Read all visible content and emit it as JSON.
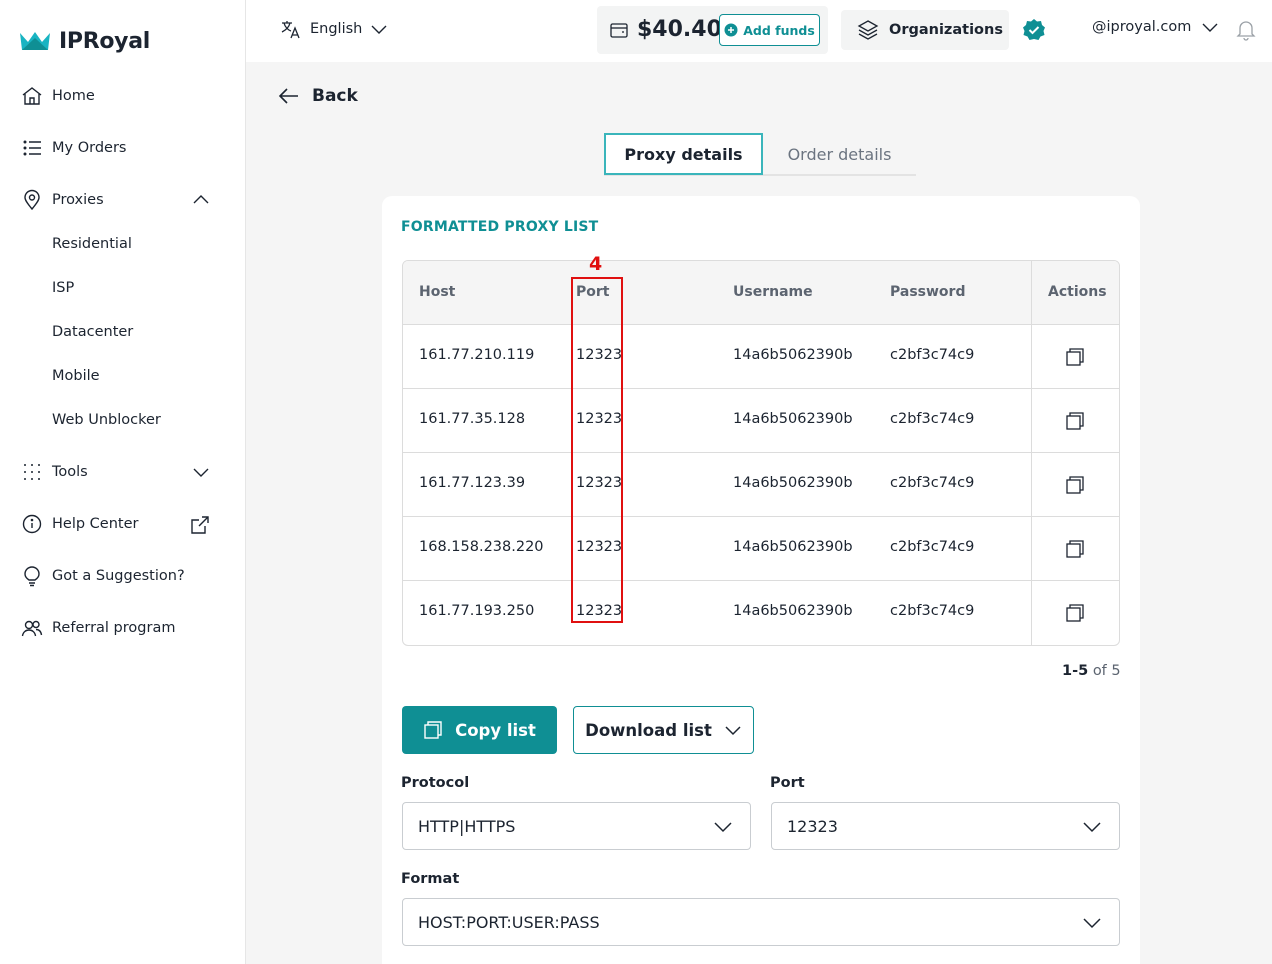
{
  "brand": {
    "name": "IPRoyal",
    "accent": "#0f8f94"
  },
  "sidebar": {
    "items": [
      {
        "label": "Home",
        "icon": "home-icon"
      },
      {
        "label": "My Orders",
        "icon": "list-icon"
      },
      {
        "label": "Proxies",
        "icon": "location-pin-icon"
      },
      {
        "label": "Tools",
        "icon": "dots-grid-icon"
      },
      {
        "label": "Help Center",
        "icon": "info-icon"
      },
      {
        "label": "Got a Suggestion?",
        "icon": "lightbulb-icon"
      },
      {
        "label": "Referral program",
        "icon": "users-icon"
      }
    ],
    "proxy_sub": [
      "Residential",
      "ISP",
      "Datacenter",
      "Mobile",
      "Web Unblocker"
    ]
  },
  "topbar": {
    "language": "English",
    "balance": "$40.40",
    "add_funds": "Add funds",
    "organizations": "Organizations",
    "user": "@iproyal.com"
  },
  "main": {
    "back": "Back",
    "tabs": [
      "Proxy details",
      "Order details"
    ],
    "section_title": "FORMATTED PROXY LIST",
    "columns": [
      "Host",
      "Port",
      "Username",
      "Password",
      "Actions"
    ],
    "rows": [
      {
        "host": "161.77.210.119",
        "port": "12323",
        "username": "14a6b5062390b",
        "password": "c2bf3c74c9"
      },
      {
        "host": "161.77.35.128",
        "port": "12323",
        "username": "14a6b5062390b",
        "password": "c2bf3c74c9"
      },
      {
        "host": "161.77.123.39",
        "port": "12323",
        "username": "14a6b5062390b",
        "password": "c2bf3c74c9"
      },
      {
        "host": "168.158.238.220",
        "port": "12323",
        "username": "14a6b5062390b",
        "password": "c2bf3c74c9"
      },
      {
        "host": "161.77.193.250",
        "port": "12323",
        "username": "14a6b5062390b",
        "password": "c2bf3c74c9"
      }
    ],
    "pagination_range": "1-5",
    "pagination_total": "of 5",
    "copy_list": "Copy list",
    "download_list": "Download list",
    "protocol_label": "Protocol",
    "protocol_value": "HTTP|HTTPS",
    "port_label": "Port",
    "port_value": "12323",
    "format_label": "Format",
    "format_value": "HOST:PORT:USER:PASS"
  },
  "annotation": {
    "label": "4"
  }
}
